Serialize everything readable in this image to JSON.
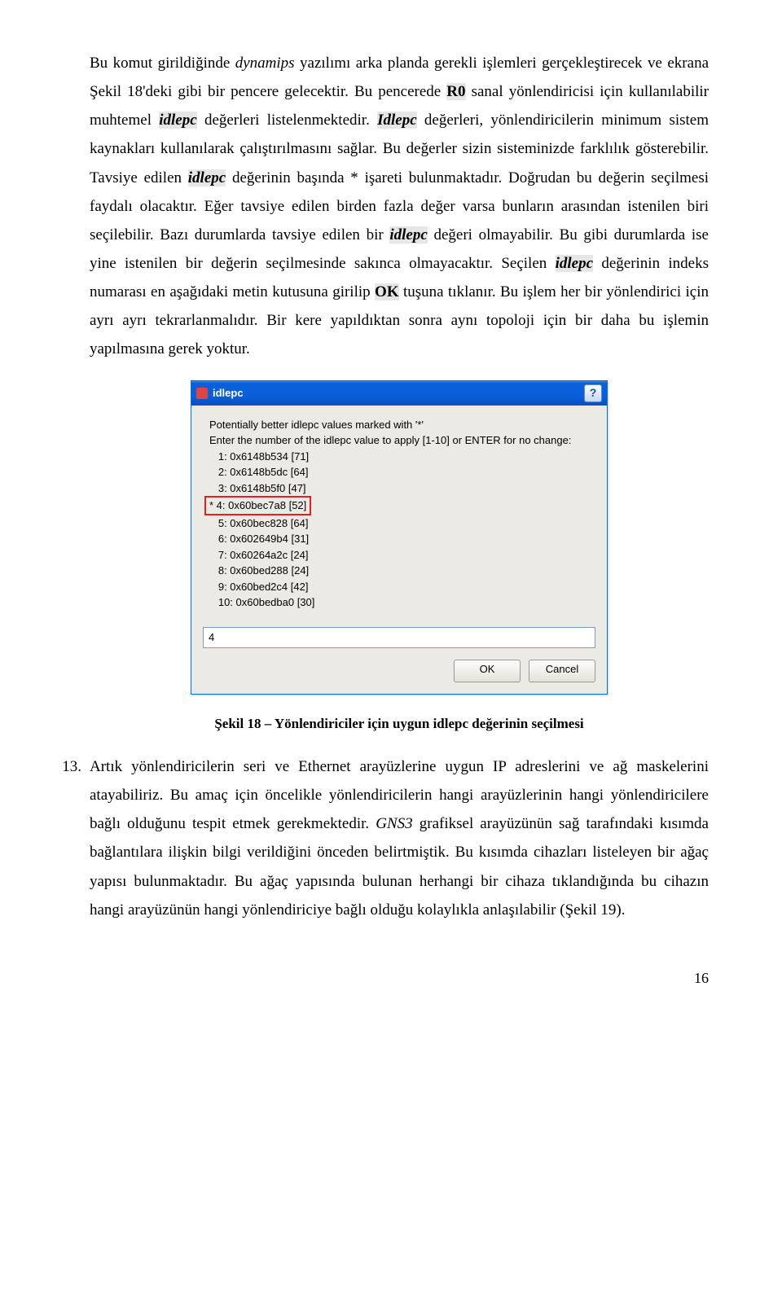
{
  "para1": {
    "t1": "Bu komut girildiğinde ",
    "t2_i": "dynamips",
    "t3": " yazılımı arka planda gerekli işlemleri gerçekleştirecek ve ekrana Şekil 18'deki gibi bir pencere gelecektir. Bu pencerede ",
    "t4_hl_b": "R0",
    "t5": " sanal yönlendiricisi için kullanılabilir muhtemel ",
    "t6_hl_bi": "idlepc",
    "t7": " değerleri listelenmektedir. ",
    "t8_hl_bi": "Idlepc",
    "t9": " değerleri, yönlendiricilerin minimum sistem kaynakları kullanılarak çalıştırılmasını sağlar. Bu değerler sizin sisteminizde farklılık gösterebilir. Tavsiye edilen ",
    "t10_hl_bi": "idlepc",
    "t11": " değerinin başında * işareti bulunmaktadır. Doğrudan bu değerin seçilmesi faydalı olacaktır. Eğer tavsiye edilen birden fazla değer varsa bunların arasından istenilen biri seçilebilir. Bazı durumlarda tavsiye edilen bir ",
    "t12_hl_bi": "idlepc",
    "t13": " değeri olmayabilir. Bu gibi durumlarda ise yine istenilen bir değerin seçilmesinde sakınca olmayacaktır. Seçilen ",
    "t14_hl_bi": "idlepc",
    "t15": " değerinin indeks numarası en aşağıdaki metin kutusuna girilip ",
    "t16_hl_b": "OK",
    "t17": " tuşuna tıklanır. Bu işlem her bir yönlendirici için ayrı ayrı tekrarlanmalıdır. Bir kere yapıldıktan sonra aynı topoloji için bir daha bu işlemin yapılmasına gerek yoktur."
  },
  "dialog": {
    "title": "idlepc",
    "help": "?",
    "line1": "Potentially better idlepc values marked with '*'",
    "line2": "Enter the number of the idlepc value to apply [1-10] or ENTER for no change:",
    "opts": [
      "   1: 0x6148b534 [71]",
      "   2: 0x6148b5dc [64]",
      "   3: 0x6148b5f0 [47]",
      "   5: 0x60bec828 [64]",
      "   6: 0x602649b4 [31]",
      "   7: 0x60264a2c [24]",
      "   8: 0x60bed288 [24]",
      "   9: 0x60bed2c4 [42]",
      "   10: 0x60bedba0 [30]"
    ],
    "opt_star": "* 4: 0x60bec7a8 [52]",
    "input_value": "4",
    "ok": "OK",
    "cancel": "Cancel"
  },
  "caption": "Şekil 18 – Yönlendiriciler için uygun idlepc değerinin seçilmesi",
  "item13": {
    "num": "13.",
    "t1": "Artık yönlendiricilerin seri ve Ethernet arayüzlerine uygun IP adreslerini ve ağ maskelerini atayabiliriz. Bu amaç için öncelikle yönlendiricilerin hangi arayüzlerinin hangi yönlendiricilere bağlı olduğunu tespit etmek gerekmektedir. ",
    "t2_i": "GNS3",
    "t3": " grafiksel arayüzünün sağ tarafındaki kısımda bağlantılara ilişkin bilgi verildiğini önceden belirtmiştik. Bu kısımda cihazları listeleyen bir ağaç yapısı bulunmaktadır. Bu ağaç yapısında bulunan herhangi bir cihaza tıklandığında bu cihazın hangi arayüzünün hangi yönlendiriciye bağlı olduğu kolaylıkla anlaşılabilir (Şekil 19)."
  },
  "page_number": "16"
}
